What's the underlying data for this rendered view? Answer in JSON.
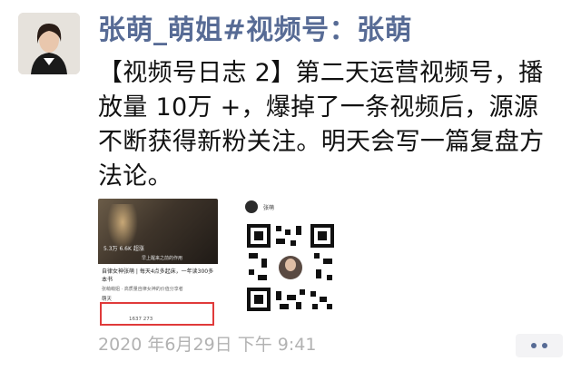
{
  "post": {
    "author_name": "张萌_萌姐#视频号：张萌",
    "text": "【视频号日志 2】第二天运营视频号，播放量 10万 +，爆掉了一条视频后，源源不断获得新粉关注。明天会写一篇复盘方法论。",
    "timestamp": "2020 年6月29日 下午 9:41"
  },
  "article_card": {
    "photo_caption": "5.3万 6.6K 超涨",
    "photo_caption2": "早上醒来之前的作用",
    "title": "自律女神张萌 | 每天4点多起床，一年读300多本书",
    "meta": "张萌萌姐 · 高质量自律女神的价值分享者",
    "author": "萌天",
    "stats": "1637   273"
  },
  "qr_card": {
    "name": "张萌"
  },
  "icons": {
    "more": "more-dots-icon"
  },
  "colors": {
    "name_link": "#576b95",
    "timestamp": "#b2b2b2",
    "highlight_box": "#e03a3a"
  }
}
